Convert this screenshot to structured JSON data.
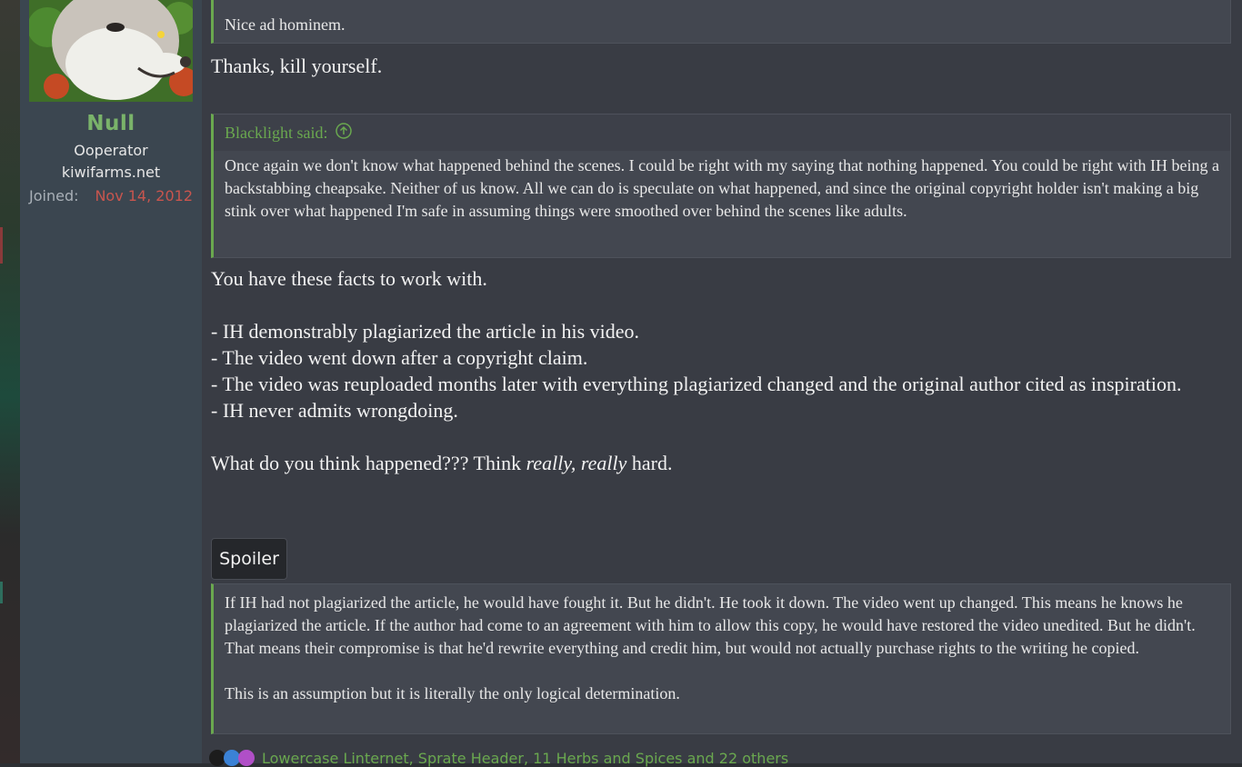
{
  "user": {
    "name": "Null",
    "title": "Ooperator",
    "site": "kiwifarms.net",
    "joined_label": "Joined:",
    "joined_value": "Nov 14, 2012"
  },
  "quote_top": {
    "text": "Nice ad hominem."
  },
  "reply_1": "Thanks, kill yourself.",
  "quote_2": {
    "header": "Blacklight said:",
    "text": "Once again we don't know what happened behind the scenes. I could be right with my saying that nothing happened. You could be right with IH being a backstabbing cheapsake. Neither of us know. All we can do is speculate on what happened, and since the original copyright holder isn't making a big stink over what happened I'm safe in assuming things were smoothed over behind the scenes like adults."
  },
  "post": {
    "intro": "You have these facts to work with.",
    "facts": [
      "- IH demonstrably plagiarized the article in his video.",
      "- The video went down after a copyright claim.",
      "- The video was reuploaded months later with everything plagiarized changed and the original author cited as inspiration.",
      "- IH never admits wrongdoing."
    ],
    "question_start": "What do you think happened??? Think ",
    "question_emph": "really, really",
    "question_end": " hard."
  },
  "spoiler": {
    "button_label": "Spoiler",
    "paragraph_1": "If IH had not plagiarized the article, he would have fought it. But he didn't. He took it down. The video went up changed. This means he knows he plagiarized the article. If the author had come to an agreement with him to allow this copy, he would have restored the video unedited. But he didn't. That means their compromise is that he'd rewrite everything and credit him, but would not actually purchase rights to the writing he copied.",
    "paragraph_2": "This is an assumption but it is literally the only logical determination."
  },
  "reactions": {
    "text": "Lowercase Linternet, Sprate Header, 11 Herbs and Spices and 22 others",
    "icons": [
      "reaction-icon-dark",
      "like-icon",
      "puzzle-icon"
    ]
  },
  "colors": {
    "accent": "#6aa84f",
    "joined": "#c8554e",
    "sidebar": "#3b4650",
    "main": "#393c44"
  }
}
